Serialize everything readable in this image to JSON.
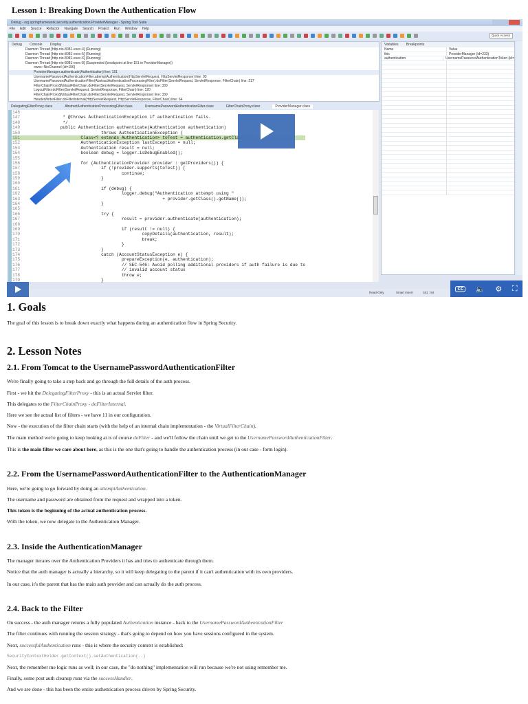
{
  "page_title": "Lesson 1: Breaking Down the Authentication Flow",
  "video": {
    "window_title": "Debug - org.springframework.security.authentication.ProviderManager - Spring Tool Suite",
    "menu": [
      "File",
      "Edit",
      "Source",
      "Refactor",
      "Navigate",
      "Search",
      "Project",
      "Run",
      "Window",
      "Help"
    ],
    "quick_access": "Quick Access",
    "debug_tabs": [
      "Debug",
      "Console",
      "Display"
    ],
    "threads": [
      "Daemon Thread [http-nio-8081-exec-4] (Running)",
      "Daemon Thread [http-nio-8081-exec-5] (Running)",
      "Daemon Thread [http-nio-8081-exec-6] (Running)",
      "Daemon Thread [http-nio-8081-exec-8] (Suspended (breakpoint at line 151 in ProviderManager))"
    ],
    "frames": [
      "owns: NioChannel (id=156)",
      "ProviderManager.authenticate(Authentication) line: 151",
      "UsernamePasswordAuthenticationFilter.attemptAuthentication(HttpServletRequest, HttpServletResponse) line: 93",
      "UsernamePasswordAuthenticationFilter(AbstractAuthenticationProcessingFilter).doFilter(ServletRequest, ServletResponse, FilterChain) line: 217",
      "FilterChainProxy$VirtualFilterChain.doFilter(ServletRequest, ServletResponse) line: 330",
      "LogoutFilter.doFilter(ServletRequest, ServletResponse, FilterChain) line: 120",
      "FilterChainProxy$VirtualFilterChain.doFilter(ServletRequest, ServletResponse) line: 330",
      "HeaderWriterFilter.doFilterInternal(HttpServletRequest, HttpServletResponse, FilterChain) line: 64"
    ],
    "editor_tabs": [
      "DelegatingFilterProxy.class",
      "AbstractAuthenticationProcessingFilter.class",
      "UsernamePasswordAuthenticationFilter.class",
      "FilterChainProxy.class",
      "ProviderManager.class"
    ],
    "code": [
      {
        "n": "146",
        "t": ""
      },
      {
        "n": "147",
        "t": "         * @throws AuthenticationException if authentication fails."
      },
      {
        "n": "148",
        "t": "         */"
      },
      {
        "n": "149",
        "t": "        public Authentication authenticate(Authentication authentication)"
      },
      {
        "n": "150",
        "t": "                        throws AuthenticationException {"
      },
      {
        "n": "151",
        "t": "                Class<? extends Authentication> toTest = authentication.getClass();"
      },
      {
        "n": "152",
        "t": "                AuthenticationException lastException = null;"
      },
      {
        "n": "153",
        "t": "                Authentication result = null;"
      },
      {
        "n": "154",
        "t": "                boolean debug = logger.isDebugEnabled();"
      },
      {
        "n": "155",
        "t": ""
      },
      {
        "n": "156",
        "t": "                for (AuthenticationProvider provider : getProviders()) {"
      },
      {
        "n": "157",
        "t": "                        if (!provider.supports(toTest)) {"
      },
      {
        "n": "158",
        "t": "                                continue;"
      },
      {
        "n": "159",
        "t": "                        }"
      },
      {
        "n": "160",
        "t": ""
      },
      {
        "n": "161",
        "t": "                        if (debug) {"
      },
      {
        "n": "162",
        "t": "                                logger.debug(\"Authentication attempt using \""
      },
      {
        "n": "163",
        "t": "                                                + provider.getClass().getName());"
      },
      {
        "n": "164",
        "t": "                        }"
      },
      {
        "n": "165",
        "t": ""
      },
      {
        "n": "166",
        "t": "                        try {"
      },
      {
        "n": "167",
        "t": "                                result = provider.authenticate(authentication);"
      },
      {
        "n": "168",
        "t": ""
      },
      {
        "n": "169",
        "t": "                                if (result != null) {"
      },
      {
        "n": "170",
        "t": "                                        copyDetails(authentication, result);"
      },
      {
        "n": "171",
        "t": "                                        break;"
      },
      {
        "n": "172",
        "t": "                                }"
      },
      {
        "n": "173",
        "t": "                        }"
      },
      {
        "n": "174",
        "t": "                        catch (AccountStatusException e) {"
      },
      {
        "n": "175",
        "t": "                                prepareException(e, authentication);"
      },
      {
        "n": "176",
        "t": "                                // SEC-546: Avoid polling additional providers if auth failure is due to"
      },
      {
        "n": "177",
        "t": "                                // invalid account status"
      },
      {
        "n": "178",
        "t": "                                throw e;"
      },
      {
        "n": "179",
        "t": "                        }"
      }
    ],
    "var_tabs": [
      "Variables",
      "Breakpoints"
    ],
    "var_headers": [
      "Name",
      "Value"
    ],
    "variables": [
      {
        "name": "this",
        "value": "ProviderManager (id=233)"
      },
      {
        "name": "authentication",
        "value": "UsernamePasswordAuthenticationToken (id="
      }
    ],
    "status": [
      "Read-Only",
      "Smart Insert",
      "151 : 84"
    ],
    "cc_label": "CC"
  },
  "content": {
    "goals_heading": "1. Goals",
    "goals_text": "The goal of this lesson is to break down exactly what happens during an authentication flow in Spring Security.",
    "notes_heading": "2. Lesson Notes",
    "s21": {
      "heading": "2.1. From Tomcat to the UsernamePasswordAuthenticationFilter",
      "p1": "We're finally going to take a step back and go through the full details of the auth process.",
      "p2a": "First - we hit the ",
      "p2b": "DelegatingFilterProxy",
      "p2c": " - this is an actual Servlet filter.",
      "p3a": "This delegates to the ",
      "p3b": "FilterChainProxy - doFilterInternal.",
      "p4": "Here we see the actual list of filters - we have 11 in our configuration.",
      "p5a": "Now - the execution of the filter chain starts (with the help of an internal chain implementation - the ",
      "p5b": "VirtualFilterChain",
      "p5c": ").",
      "p6a": "The main method we're going to keep looking at is of course ",
      "p6b": "doFilter",
      "p6c": " - and we'll follow the chain until we get to the ",
      "p6d": "UsernamePasswordAuthenticationFilter",
      "p6e": ".",
      "p7a": "This is ",
      "p7b": "the main filter we care about here",
      "p7c": ", as this is the one that's going to handle the authentication process (in our case - form login)."
    },
    "s22": {
      "heading": "2.2. From the UsernamePasswordAuthenticationFilter to the AuthenticationManager",
      "p1a": "Here, we're going to go forward by doing an ",
      "p1b": "attemptAuthentication",
      "p1c": ".",
      "p2": "The username and password are obtained from the request and wrapped into a token.",
      "p3": "This token is the beginning of the actual authentication process.",
      "p4": "With the token, we now delegate to the Authentication Manager."
    },
    "s23": {
      "heading": "2.3. Inside the AuthenticationManager",
      "p1": "The manager iterates over the Authentication Providers it has and tries to authenticate through them.",
      "p2": "Notice that the auth manager is actually a hierarchy, so it will keep delegating to the parent if it can't authentication with its own providers.",
      "p3": "In our case, it's the parent that has the main auth provider and can actually do the auth process."
    },
    "s24": {
      "heading": "2.4. Back to the Filter",
      "p1a": "On success - the auth manager returns a fully populated ",
      "p1b": "Authentication",
      "p1c": " instance - back to the ",
      "p1d": "UsernamePasswordAuthenticationFilter",
      "p2": "The filter continues with running the session strategy - that's going to depend on how you have sessions configured in the system.",
      "p3a": "Next, ",
      "p3b": "successfulAuthentication",
      "p3c": " runs - this is where the security context is established:",
      "code": "SecurityContextHolder.getContext().setAuthentication(..)",
      "p4": "Next, the remember me logic runs as well; in our case, the \"do nothing\" implementation will run because we're not using remember me.",
      "p5a": "Finally, some post auth cleanup runs via the ",
      "p5b": "successHandler",
      "p5c": ".",
      "p6": "And we are done - this has been the entire authentication process driven by Spring Security."
    }
  }
}
